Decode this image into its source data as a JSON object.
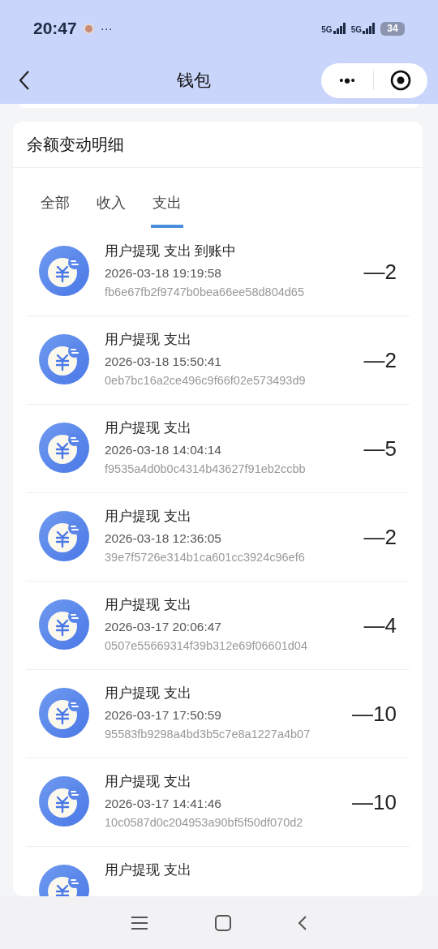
{
  "status_bar": {
    "time": "20:47",
    "dots": "···",
    "network_1": "5G",
    "network_2": "5G",
    "battery": "34"
  },
  "nav": {
    "title": "钱包",
    "menu_dots": "•●•"
  },
  "card": {
    "title": "余额变动明细"
  },
  "tabs": [
    {
      "label": "全部",
      "selected": false
    },
    {
      "label": "收入",
      "selected": false
    },
    {
      "label": "支出",
      "selected": true
    }
  ],
  "records": [
    {
      "title": "用户提现 支出 到账中",
      "time": "2026-03-18 19:19:58",
      "id": "fb6e67fb2f9747b0bea66ee58d804d65",
      "amount": "—2"
    },
    {
      "title": "用户提现 支出",
      "time": "2026-03-18 15:50:41",
      "id": "0eb7bc16a2ce496c9f66f02e573493d9",
      "amount": "—2"
    },
    {
      "title": "用户提现 支出",
      "time": "2026-03-18 14:04:14",
      "id": "f9535a4d0b0c4314b43627f91eb2ccbb",
      "amount": "—5"
    },
    {
      "title": "用户提现 支出",
      "time": "2026-03-18 12:36:05",
      "id": "39e7f5726e314b1ca601cc3924c96ef6",
      "amount": "—2"
    },
    {
      "title": "用户提现 支出",
      "time": "2026-03-17 20:06:47",
      "id": "0507e55669314f39b312e69f06601d04",
      "amount": "—4"
    },
    {
      "title": "用户提现 支出",
      "time": "2026-03-17 17:50:59",
      "id": "95583fb9298a4bd3b5c7e8a1227a4b07",
      "amount": "—10"
    },
    {
      "title": "用户提现 支出",
      "time": "2026-03-17 14:41:46",
      "id": "10c0587d0c204953a90bf5f50df070d2",
      "amount": "—10"
    },
    {
      "title": "用户提现 支出"
    }
  ]
}
